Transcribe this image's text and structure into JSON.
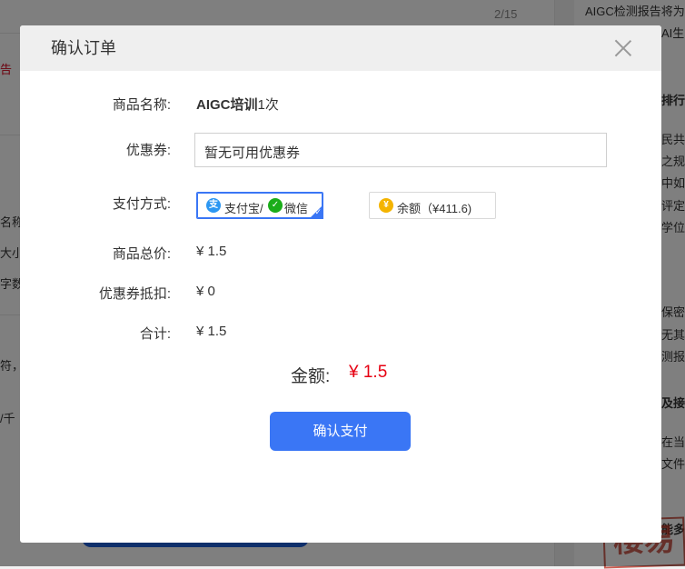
{
  "background": {
    "page_counter": "2/15",
    "right_heading": "AIGC检测报告将为",
    "right_line_2": "AI生",
    "right_snippets": [
      "排行A",
      "民共",
      "之规",
      "中如",
      "评定",
      "学位",
      "保密",
      "无其",
      "测报",
      "及接收",
      "在当",
      "文件",
      "能多久"
    ],
    "left_snippets": [
      "告",
      "名称",
      "大小",
      "字数",
      "符，",
      "/千"
    ],
    "watermark": "楼易"
  },
  "dialog": {
    "title": "确认订单",
    "fields": {
      "product_name_label": "商品名称:",
      "product_name_bold": "AIGC培训",
      "product_name_rest": "1次",
      "coupon_label": "优惠券:",
      "coupon_value": "暂无可用优惠券",
      "payment_label": "支付方式:",
      "payment_options": [
        {
          "label": "支付宝/",
          "label_2": "微信",
          "selected": true,
          "icons": [
            "alipay-icon",
            "wechat-icon"
          ]
        },
        {
          "label": "余额（¥411.6)",
          "selected": false,
          "icons": [
            "balance-icon"
          ]
        }
      ],
      "total_price_label": "商品总价:",
      "total_price_value": "¥ 1.5",
      "coupon_discount_label": "优惠券抵扣:",
      "coupon_discount_value": "¥ 0",
      "sum_label": "合计:",
      "sum_value": "¥ 1.5"
    },
    "amount_label": "金额:",
    "amount_value": "¥ 1.5",
    "confirm_button": "确认支付"
  },
  "colors": {
    "accent": "#3a76f5",
    "price_red": "#e60012",
    "alipay": "#2c97f2",
    "wechat": "#1aad19",
    "balance": "#f4b400"
  }
}
